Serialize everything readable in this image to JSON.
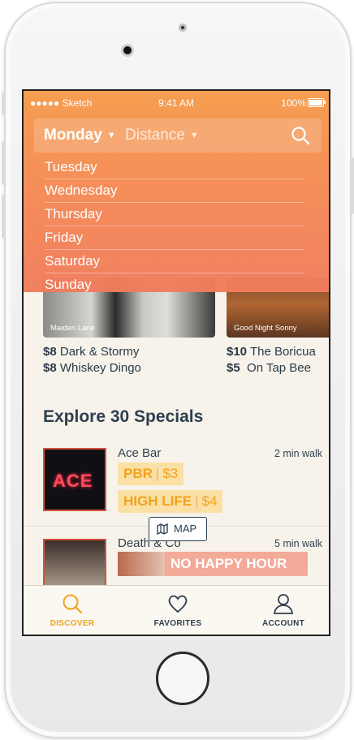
{
  "status_bar": {
    "signal": "●●●●● Sketch",
    "time": "9:41 AM",
    "battery": "100%"
  },
  "filters": {
    "day": "Monday",
    "sort": "Distance",
    "day_options": [
      "Tuesday",
      "Wednesday",
      "Thursday",
      "Friday",
      "Saturday",
      "Sunday"
    ]
  },
  "cards": [
    {
      "label": "Maiden Lane",
      "specials": [
        {
          "price": "$8",
          "name": "Dark & Stormy"
        },
        {
          "price": "$8",
          "name": "Whiskey Dingo"
        }
      ]
    },
    {
      "label": "Good Night Sonny",
      "specials": [
        {
          "price": "$10",
          "name": "The Boricua"
        },
        {
          "price": "$5",
          "name": "On Tap Bee"
        }
      ]
    }
  ],
  "section_title": "Explore 30 Specials",
  "list": [
    {
      "name": "Ace Bar",
      "walk": "2 min walk",
      "thumb_text": "ACE",
      "deals": [
        {
          "name": "PBR",
          "price": "$3"
        },
        {
          "name": "HIGH LIFE",
          "price": "$4"
        }
      ]
    },
    {
      "name": "Death & Co",
      "walk": "5 min walk",
      "badge": "NO HAPPY HOUR"
    }
  ],
  "map_button": "MAP",
  "tabs": [
    {
      "label": "DISCOVER",
      "icon": "search-icon",
      "active": true
    },
    {
      "label": "FAVORITES",
      "icon": "heart-icon",
      "active": false
    },
    {
      "label": "ACCOUNT",
      "icon": "user-icon",
      "active": false
    }
  ],
  "colors": {
    "accent": "#f2a21c",
    "overlay": "#f58a56",
    "text": "#2e3f50",
    "background": "#f7f3ea"
  }
}
